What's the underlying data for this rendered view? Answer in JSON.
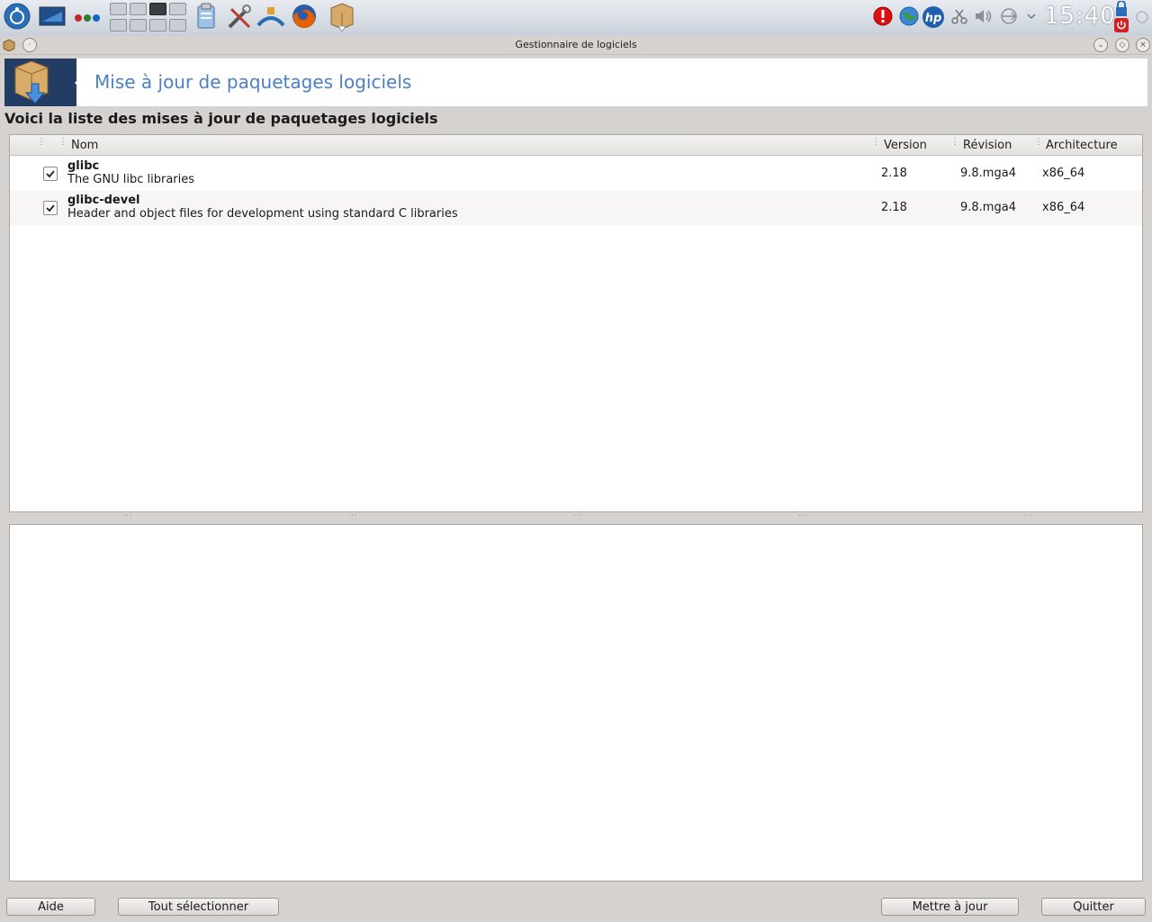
{
  "taskbar": {
    "clock": "15:40",
    "hp_label": "hp"
  },
  "window": {
    "title": "Gestionnaire de logiciels"
  },
  "header": {
    "title": "Mise à jour de paquetages logiciels",
    "subtitle": "Voici la liste des mises à jour de paquetages logiciels"
  },
  "columns": {
    "name": "Nom",
    "version": "Version",
    "revision": "Révision",
    "architecture": "Architecture"
  },
  "packages": [
    {
      "name": "glibc",
      "description": "The GNU libc libraries",
      "version": "2.18",
      "revision": "9.8.mga4",
      "arch": "x86_64",
      "checked": true
    },
    {
      "name": "glibc-devel",
      "description": "Header and object files for development using standard C libraries",
      "version": "2.18",
      "revision": "9.8.mga4",
      "arch": "x86_64",
      "checked": true
    }
  ],
  "buttons": {
    "help": "Aide",
    "select_all": "Tout sélectionner",
    "update": "Mettre à jour",
    "quit": "Quitter"
  },
  "colors": {
    "accent_title": "#4b80c2",
    "banner_icon_bg": "#233c63"
  }
}
